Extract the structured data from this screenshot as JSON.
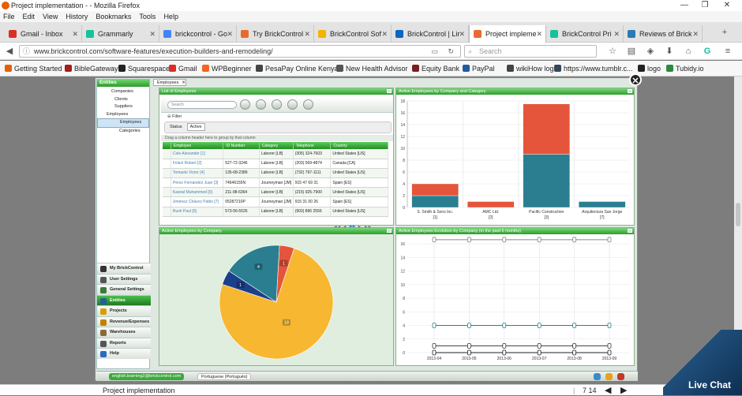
{
  "window": {
    "title": "Project implementation - - Mozilla Firefox",
    "minimize": "—",
    "maximize": "❐",
    "close": "✕"
  },
  "menu": [
    "File",
    "Edit",
    "View",
    "History",
    "Bookmarks",
    "Tools",
    "Help"
  ],
  "tabs": [
    {
      "label": "Gmail - Inbox",
      "color": "#d93025"
    },
    {
      "label": "Grammarly",
      "color": "#15c39a"
    },
    {
      "label": "brickcontrol - Go",
      "color": "#4285f4"
    },
    {
      "label": "Try BrickControl",
      "color": "#e86b2e"
    },
    {
      "label": "BrickControl Sof",
      "color": "#f4b400"
    },
    {
      "label": "BrickControl | Lir",
      "color": "#0a66c2"
    },
    {
      "label": "Project impleme",
      "color": "#e86b2e"
    },
    {
      "label": "BrickControl Pri",
      "color": "#15c39a"
    },
    {
      "label": "Reviews of Brick",
      "color": "#2a7ab8"
    }
  ],
  "nav": {
    "url": "www.brickcontrol.com/software-features/execution-builders-and-remodeling/",
    "search_placeholder": "Search"
  },
  "bookmarks": [
    {
      "label": "Getting Started",
      "color": "#e66000"
    },
    {
      "label": "BibleGateway",
      "color": "#a31d1d"
    },
    {
      "label": "Squarespace",
      "color": "#222"
    },
    {
      "label": "Gmail",
      "color": "#d93025"
    },
    {
      "label": "WPBeginner",
      "color": "#f26522"
    },
    {
      "label": "PesaPay Online Kenya",
      "color": "#444"
    },
    {
      "label": "New Health Advisor",
      "color": "#555"
    },
    {
      "label": "Equity Bank",
      "color": "#7a1f1f"
    },
    {
      "label": "PayPal",
      "color": "#1f5aa6"
    },
    {
      "label": "wikiHow logo",
      "color": "#444"
    },
    {
      "label": "https://www.tumblr.c...",
      "color": "#35465c"
    },
    {
      "label": "logo",
      "color": "#222"
    },
    {
      "label": "Tubidy.io",
      "color": "#2b8a3e"
    }
  ],
  "app": {
    "entities_header": "Entities",
    "tree": [
      "Companies",
      "Clients",
      "Suppliers",
      "Employees",
      "Employees",
      "Categories"
    ],
    "navitems": [
      {
        "label": "My BrickControl",
        "color": "#333"
      },
      {
        "label": "User Settings",
        "color": "#555"
      },
      {
        "label": "General Settings",
        "color": "#3a7a3a"
      },
      {
        "label": "Entities",
        "color": "#2060a0"
      },
      {
        "label": "Projects",
        "color": "#d4a000"
      },
      {
        "label": "Revenue/Expenses",
        "color": "#c08000"
      },
      {
        "label": "Warehouses",
        "color": "#8a6a3a"
      },
      {
        "label": "Reports",
        "color": "#555"
      },
      {
        "label": "Help",
        "color": "#2a6ac0"
      }
    ],
    "employees_tab": "Employees",
    "list_title": "List of Employees",
    "search_placeholder": "Search",
    "filter_label": "Filter",
    "status_label": "Status",
    "status_value": "Active",
    "group_hint": "Drag a column header here to group by that column",
    "columns": [
      "Employee",
      "ID Number",
      "Category",
      "Telephone",
      "Country"
    ],
    "rows": [
      [
        "Cole Alexander [1]",
        "",
        "Laborer [LB]",
        "(305) 324-7603",
        "United States [US]"
      ],
      [
        "Felsol Robert [2]",
        "527-72-3246",
        "Laborer [LB]",
        "(203) 569-4874",
        "Canada [CA]"
      ],
      [
        "Tomasto Victor [4]",
        "135-68-2389",
        "Laborer [LB]",
        "(732) 797-1111",
        "United States [US]"
      ],
      [
        "Pérez Fernández Juan [3]",
        "74646155N",
        "Journeyman [JM]",
        "915 47 69 31",
        "Spain [ES]"
      ],
      [
        "Kasnal Muhammed [0]",
        "211-98-6364",
        "Laborer [LB]",
        "(215) 925-7900",
        "United States [US]"
      ],
      [
        "Jiménez Chávez Pablo [7]",
        "05287210P",
        "Journeyman [JM]",
        "915 31 00 26",
        "Spain [ES]"
      ],
      [
        "Rush Paul [0]",
        "573-56-5526",
        "Laborer [LB]",
        "(903) 896 2556",
        "United States [US]"
      ]
    ],
    "pager": [
      "◀◀",
      "◀",
      "1",
      "▶",
      "▶▶"
    ],
    "bottom_email": "english.learning2@brickcontrol.com",
    "bottom_language": "Portuguese (Portugués)"
  },
  "chart_data": [
    {
      "type": "bar",
      "title": "Active Employees by Company and Category",
      "categories": [
        "S. Smith & Sons Inc.",
        "AMC Ltd.",
        "Pacific Construction",
        "Arquitectura San Jorge"
      ],
      "category_counts": [
        "[1]",
        "[2]",
        "[3]",
        "[7]"
      ],
      "series": [
        {
          "color": "#2a7e8f",
          "values": [
            2,
            0,
            9,
            1
          ]
        },
        {
          "color": "#e4553b",
          "values": [
            2,
            1,
            8.5,
            0
          ]
        }
      ],
      "ylim": [
        0,
        18
      ],
      "yticks": [
        0,
        2,
        4,
        6,
        8,
        10,
        12,
        14,
        16,
        18
      ]
    },
    {
      "type": "pie",
      "title": "Active Employees by Company",
      "slices": [
        {
          "value": 18,
          "color": "#f7b731"
        },
        {
          "value": 1,
          "color": "#1c3f8a"
        },
        {
          "value": 4,
          "color": "#2a7e8f"
        },
        {
          "value": 1,
          "color": "#e4553b"
        }
      ]
    },
    {
      "type": "line",
      "title": "Active Employees Evolution by Company (in the past 6 months)",
      "x": [
        "2013-04",
        "2013-05",
        "2013-06",
        "2013-07",
        "2013-08",
        "2013-09"
      ],
      "series": [
        {
          "color": "#888",
          "values": [
            18,
            18,
            18,
            18,
            18,
            18
          ]
        },
        {
          "color": "#2a7e8f",
          "values": [
            4,
            4,
            4,
            4,
            4,
            4
          ]
        },
        {
          "color": "#3a3a3a",
          "values": [
            1,
            1,
            1,
            1,
            1,
            1
          ]
        },
        {
          "color": "#222",
          "values": [
            0,
            0,
            0,
            0,
            0,
            0
          ]
        }
      ],
      "ylim": [
        0,
        16
      ],
      "yticks": [
        0,
        2,
        4,
        6,
        8,
        10,
        12,
        14,
        16
      ]
    }
  ],
  "statusbar": {
    "text": "Project implementation",
    "page": "7",
    "total": "14"
  },
  "livechat": "Live Chat"
}
